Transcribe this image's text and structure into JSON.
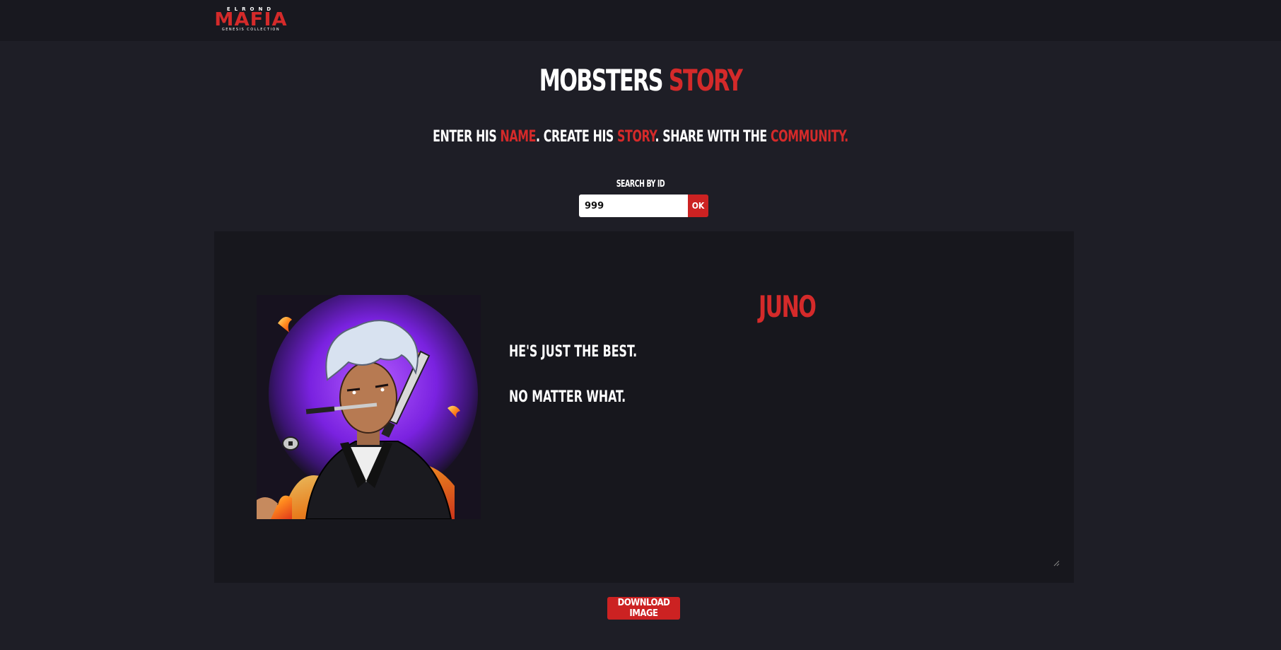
{
  "logo": {
    "top_text": "ELROND",
    "main_text": "MAFIA",
    "bottom_text": "GENESIS COLLECTION"
  },
  "title": {
    "part1": "MOBSTERS",
    "part2": "STORY"
  },
  "subtitle": {
    "t1": "ENTER HIS ",
    "t2": "NAME",
    "t3": ". CREATE HIS ",
    "t4": "STORY",
    "t5": ". SHARE WITH THE ",
    "t6": "COMMUNITY."
  },
  "search": {
    "label": "SEARCH BY ID",
    "value": "999",
    "button_label": "OK"
  },
  "card": {
    "name": "JUNO",
    "story_lines": [
      "HE'S JUST THE BEST.",
      "NO MATTER WHAT."
    ],
    "avatar_icon": "mobster-portrait"
  },
  "download": {
    "label": "DOWNLOAD IMAGE"
  },
  "colors": {
    "accent": "#d42a2a",
    "background": "#1e1e26",
    "topbar": "#18181f",
    "card": "#17171d"
  }
}
